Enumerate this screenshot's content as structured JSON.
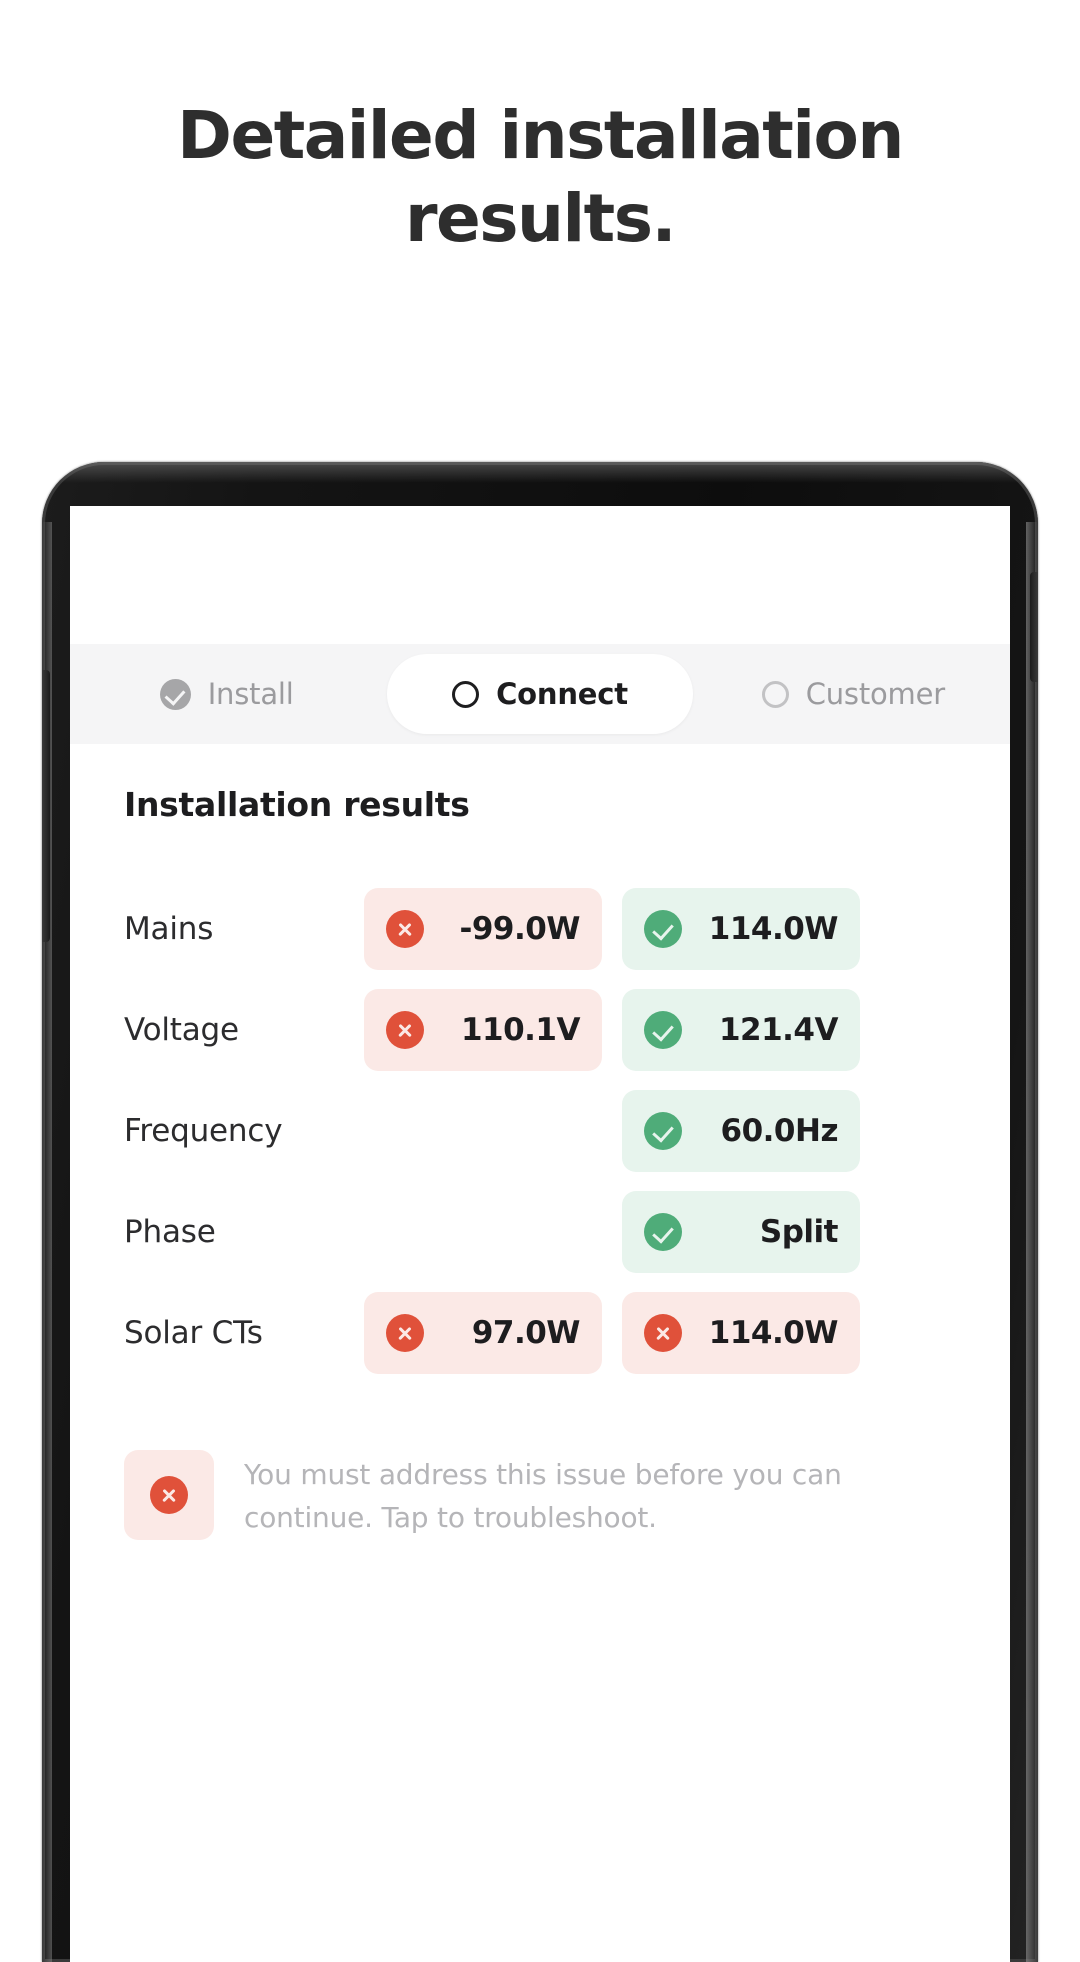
{
  "promo": {
    "headline": "Detailed installation\nresults."
  },
  "phone": {
    "hardware": {
      "front_camera": "front-camera",
      "earpiece": "earpiece-speaker",
      "sensor_a": "proximity-sensor",
      "sensor_b": "light-sensor",
      "power_button": "power-button",
      "volume_button": "volume-button"
    }
  },
  "app": {
    "tabs": [
      {
        "label": "Install",
        "icon": "check-circle-filled-icon",
        "state": "completed"
      },
      {
        "label": "Connect",
        "icon": "circle-outline-icon",
        "state": "active"
      },
      {
        "label": "Customer",
        "icon": "circle-outline-icon",
        "state": "upcoming"
      }
    ],
    "section_title": "Installation results",
    "results": [
      {
        "label": "Mains",
        "cells": [
          {
            "status": "fail",
            "icon": "error-circle-icon",
            "value": "-99.0W"
          },
          {
            "status": "pass",
            "icon": "check-circle-icon",
            "value": "114.0W"
          }
        ]
      },
      {
        "label": "Voltage",
        "cells": [
          {
            "status": "fail",
            "icon": "error-circle-icon",
            "value": "110.1V"
          },
          {
            "status": "pass",
            "icon": "check-circle-icon",
            "value": "121.4V"
          }
        ]
      },
      {
        "label": "Frequency",
        "cells": [
          {
            "status": "empty",
            "icon": "",
            "value": ""
          },
          {
            "status": "pass",
            "icon": "check-circle-icon",
            "value": "60.0Hz"
          }
        ]
      },
      {
        "label": "Phase",
        "cells": [
          {
            "status": "empty",
            "icon": "",
            "value": ""
          },
          {
            "status": "pass",
            "icon": "check-circle-icon",
            "value": "Split"
          }
        ]
      },
      {
        "label": "Solar CTs",
        "cells": [
          {
            "status": "fail",
            "icon": "error-circle-icon",
            "value": "97.0W"
          },
          {
            "status": "fail",
            "icon": "error-circle-icon",
            "value": "114.0W"
          }
        ]
      }
    ],
    "notice": {
      "icon": "error-circle-icon",
      "text": "You must address this issue before you can continue. Tap to troubleshoot."
    }
  },
  "colors": {
    "fail_accent": "#e0513a",
    "fail_background": "#fbe9e6",
    "pass_accent": "#4fac79",
    "pass_background": "#e7f4ed",
    "tab_bar_background": "#f5f5f6",
    "text_primary": "#1d1d1f",
    "text_muted": "#9b9b9e",
    "notice_text": "#b5b5b8"
  }
}
